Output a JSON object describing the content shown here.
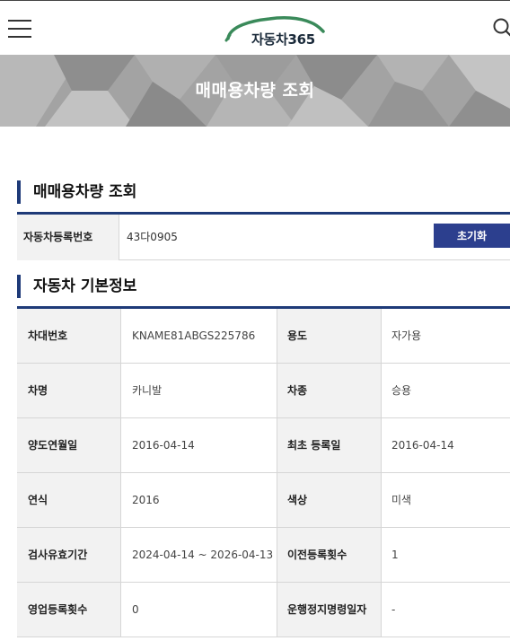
{
  "header": {
    "logo_text": "자동차365"
  },
  "banner": {
    "title": "매매용차량 조회"
  },
  "search_section": {
    "title": "매매용차량 조회",
    "label": "자동차등록번호",
    "value": "43다0905",
    "reset_label": "초기화"
  },
  "info_section": {
    "title": "자동차 기본정보",
    "rows": [
      {
        "label1": "차대번호",
        "value1": "KNAME81ABGS225786",
        "label2": "용도",
        "value2": "자가용"
      },
      {
        "label1": "차명",
        "value1": "카니발",
        "label2": "차종",
        "value2": "승용"
      },
      {
        "label1": "양도연월일",
        "value1": "2016-04-14",
        "label2": "최초 등록일",
        "value2": "2016-04-14"
      },
      {
        "label1": "연식",
        "value1": "2016",
        "label2": "색상",
        "value2": "미색"
      },
      {
        "label1": "검사유효기간",
        "value1": "2024-04-14 ~ 2026-04-13",
        "label2": "이전등록횟수",
        "value2": "1"
      },
      {
        "label1": "영업등록횟수",
        "value1": "0",
        "label2": "운행정지명령일자",
        "value2": "-"
      }
    ]
  },
  "colors": {
    "accent_navy": "#1e3a78",
    "button_blue": "#2c3f8e",
    "logo_green": "#3a8a5a"
  }
}
